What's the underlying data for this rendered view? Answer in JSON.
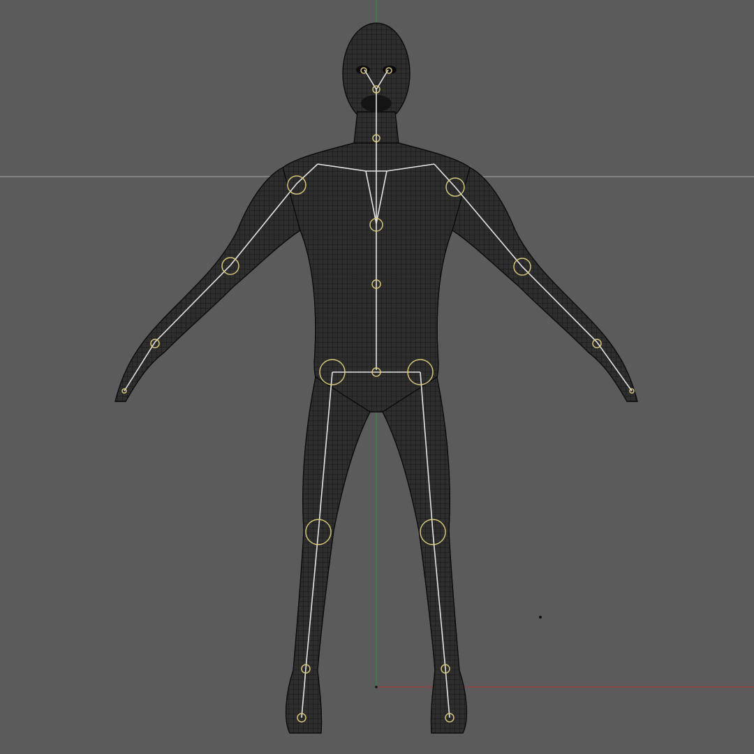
{
  "viewport": {
    "background": "#5b5b5b",
    "view": "front-orthographic",
    "display_mode": "wireframe",
    "content": "rigged-human-mesh",
    "colors": {
      "mesh_fill": "#2e2e2e",
      "mesh_wire": "#0e0e0e",
      "bone": "#e6e6e6",
      "joint": "#d8c878",
      "axis_x": "#b03030",
      "axis_y": "#2e9a3a",
      "horizon_line": "#a8a8a8"
    },
    "icons": [
      "world-origin-icon",
      "3d-cursor-icon"
    ]
  }
}
